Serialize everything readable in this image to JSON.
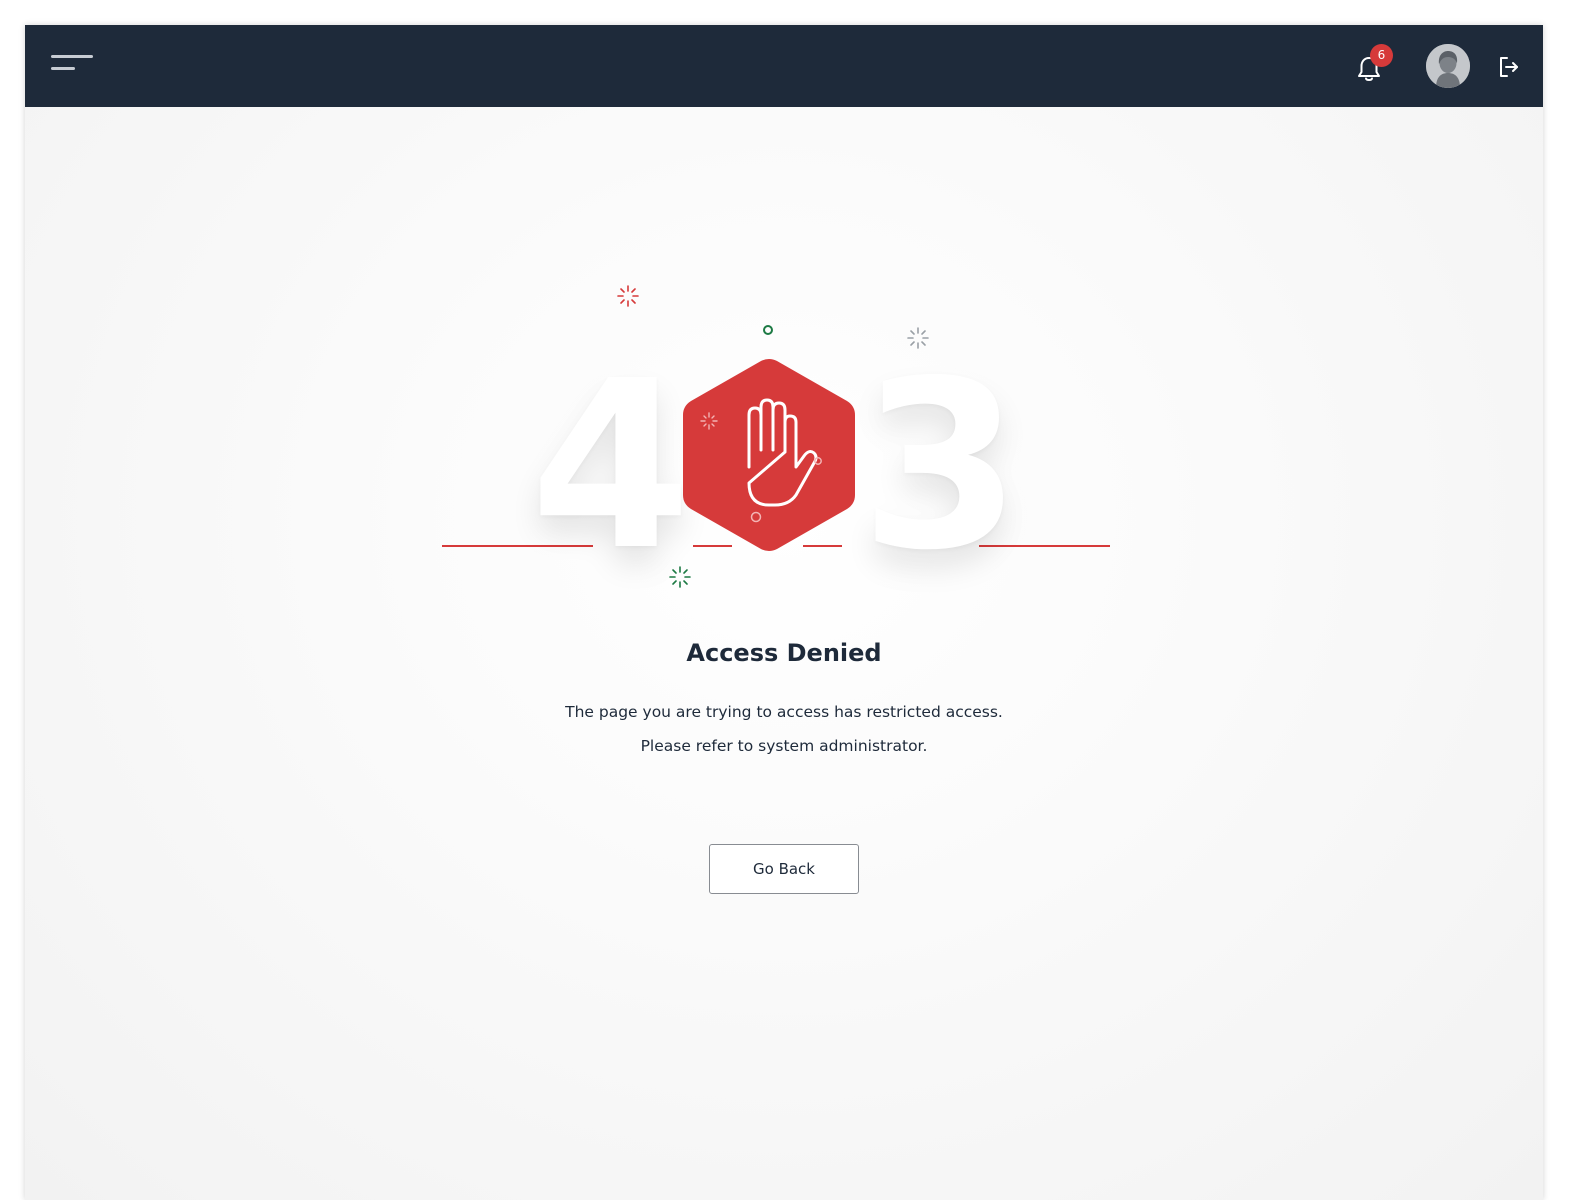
{
  "header": {
    "menu_icon": "hamburger-menu-icon",
    "notifications": {
      "icon": "bell-icon",
      "count": "6"
    },
    "avatar_icon": "user-avatar",
    "logout_icon": "logout-icon"
  },
  "error": {
    "code_left": "4",
    "code_right": "3",
    "center_icon": "stop-hand-hexagon-icon",
    "title": "Access Denied",
    "message_line1": "The page you are trying to access has restricted access.",
    "message_line2": "Please refer to system administrator.",
    "button_label": "Go Back"
  },
  "colors": {
    "topbar": "#1e2a3a",
    "accent_red": "#d63a3a",
    "accent_green": "#1d7a44",
    "text_dark": "#1e2a3a"
  }
}
